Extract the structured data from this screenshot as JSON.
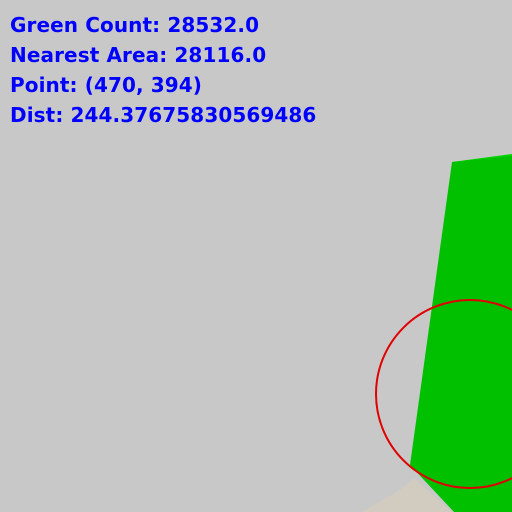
{
  "overlay": {
    "green_count": "Green Count: 28532.0",
    "nearest_area": "Nearest Area: 28116.0",
    "point": "Point: (470, 394)",
    "dist": "Dist: 244.37675830569486"
  },
  "colors": {
    "background": "#c8c8c8",
    "text": "#0000ff",
    "green_object": "#00c000",
    "green_object_top": "#00d400",
    "marker_circle": "#e00000",
    "floor": "#d2cbbf"
  },
  "icons": {
    "target_marker": "target-circle-icon"
  }
}
